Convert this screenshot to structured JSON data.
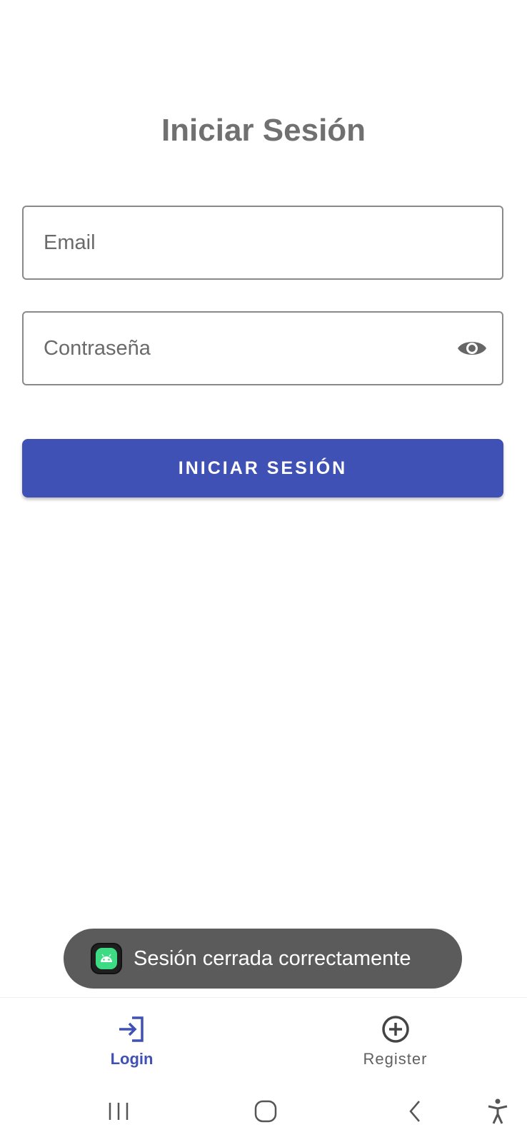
{
  "screen": {
    "title": "Iniciar Sesión"
  },
  "form": {
    "email_placeholder": "Email",
    "password_placeholder": "Contraseña",
    "password_visibility_icon": "eye-icon",
    "submit_label": "INICIAR SESIÓN"
  },
  "toast": {
    "message": "Sesión cerrada correctamente",
    "app_icon": "android-icon"
  },
  "bottom_nav": {
    "items": [
      {
        "label": "Login",
        "icon": "login-icon",
        "selected": true
      },
      {
        "label": "Register",
        "icon": "add-circle-icon",
        "selected": false
      }
    ]
  },
  "system_nav": {
    "buttons": [
      "recents-icon",
      "home-icon",
      "back-icon",
      "accessibility-icon"
    ]
  },
  "colors": {
    "primary": "#3f51b5",
    "title_text": "#707070",
    "toast_background": "#5b5b5b",
    "field_border": "#8a8a8a"
  }
}
